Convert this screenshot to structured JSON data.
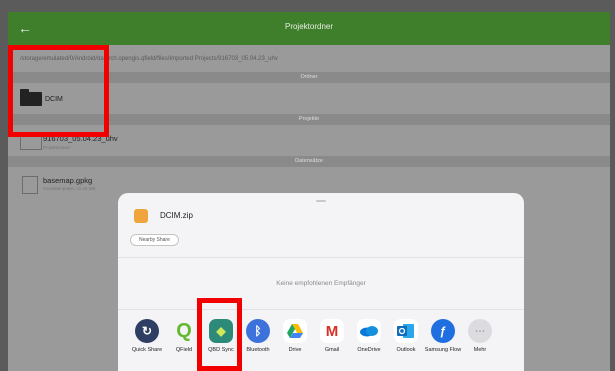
{
  "app_bar": {
    "title": "Projektordner",
    "back_glyph": "←"
  },
  "path": "/storage/emulated/0/Android/data/ch.opengis.qfield/files/Imported Projects/916703_05.04.23_uhv",
  "sections": {
    "folders": "Ordner",
    "projects": "Projekte",
    "datasets": "Datensätze"
  },
  "folder": {
    "name": "DCIM"
  },
  "project": {
    "name": "916703_05.04.23_uhv",
    "subtitle": "Projektordner"
  },
  "dataset": {
    "name": "basemap.gpkg",
    "subtitle": "Geodatenpaket, 22.25 MB"
  },
  "share_sheet": {
    "file_name": "DCIM.zip",
    "nearby_share_label": "Nearby Share",
    "empty_message": "Keine empfohlenen Empfänger",
    "apps": [
      {
        "label": "Quick Share",
        "icon": "quick-share-icon",
        "color": "#2f3f63"
      },
      {
        "label": "QField",
        "icon": "qfield-icon",
        "color": "#66b832"
      },
      {
        "label": "QBD Sync",
        "icon": "qbd-sync-icon",
        "color": "#2d8a78"
      },
      {
        "label": "Bluetooth",
        "icon": "bluetooth-icon",
        "color": "#3d72dc"
      },
      {
        "label": "Drive",
        "icon": "drive-icon",
        "color": "#1fa463"
      },
      {
        "label": "Gmail",
        "icon": "gmail-icon",
        "color": "#d93025"
      },
      {
        "label": "OneDrive",
        "icon": "onedrive-icon",
        "color": "#0a78d4"
      },
      {
        "label": "Outlook",
        "icon": "outlook-icon",
        "color": "#0f6cbd"
      },
      {
        "label": "Samsung Flow",
        "icon": "samsung-flow-icon",
        "color": "#1f6fe0"
      },
      {
        "label": "Mehr",
        "icon": "more-icon",
        "color": "#dcdce0"
      }
    ]
  },
  "highlight_color": "#f20000"
}
